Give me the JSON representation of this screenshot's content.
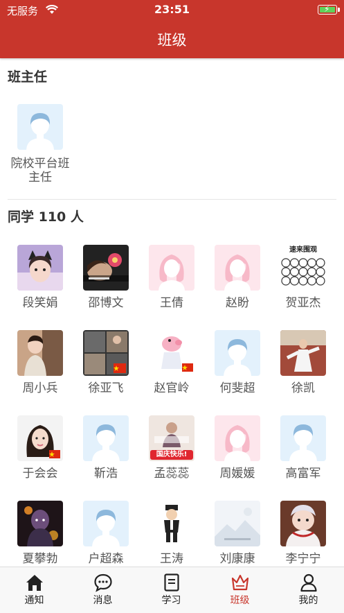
{
  "status_bar": {
    "carrier": "无服务",
    "time": "23:51"
  },
  "header": {
    "title": "班级"
  },
  "teacher_section": {
    "title": "班主任",
    "teacher": {
      "name_line1": "院校平台班",
      "name_line2": "主任",
      "avatar": "default-male"
    }
  },
  "classmates_section": {
    "title": "同学 110 人",
    "students": [
      {
        "name": "段笑娟",
        "avatar": "photo-girl-cat-ears"
      },
      {
        "name": "邵博文",
        "avatar": "photo-flower"
      },
      {
        "name": "王倩",
        "avatar": "default-female"
      },
      {
        "name": "赵盼",
        "avatar": "default-female"
      },
      {
        "name": "贺亚杰",
        "avatar": "cartoon-crowd",
        "avatar_caption": "速来围观"
      },
      {
        "name": "周小兵",
        "avatar": "photo-child"
      },
      {
        "name": "徐亚飞",
        "avatar": "photo-collage"
      },
      {
        "name": "赵官岭",
        "avatar": "cartoon-pig"
      },
      {
        "name": "何斐超",
        "avatar": "default-male"
      },
      {
        "name": "徐凯",
        "avatar": "photo-taichi"
      },
      {
        "name": "于会会",
        "avatar": "photo-woman"
      },
      {
        "name": "靳浩",
        "avatar": "default-male"
      },
      {
        "name": "孟蕊蕊",
        "avatar": "photo-national-day",
        "avatar_caption": "国庆快乐!"
      },
      {
        "name": "周媛媛",
        "avatar": "default-female"
      },
      {
        "name": "高富军",
        "avatar": "default-male"
      },
      {
        "name": "夏攀勃",
        "avatar": "photo-villain"
      },
      {
        "name": "户超森",
        "avatar": "default-male"
      },
      {
        "name": "王涛",
        "avatar": "cartoon-man"
      },
      {
        "name": "刘康康",
        "avatar": "image-placeholder"
      },
      {
        "name": "李宁宁",
        "avatar": "photo-baby"
      }
    ]
  },
  "tab_bar": {
    "active": "班级",
    "tabs": [
      {
        "label": "通知",
        "icon": "home-icon"
      },
      {
        "label": "消息",
        "icon": "chat-bubble-icon"
      },
      {
        "label": "学习",
        "icon": "document-icon"
      },
      {
        "label": "班级",
        "icon": "crown-icon"
      },
      {
        "label": "我的",
        "icon": "person-icon"
      }
    ]
  },
  "colors": {
    "brand": "#c8362c",
    "default_male_bg": "#e3f1fc",
    "default_female_bg": "#fde6ec"
  }
}
